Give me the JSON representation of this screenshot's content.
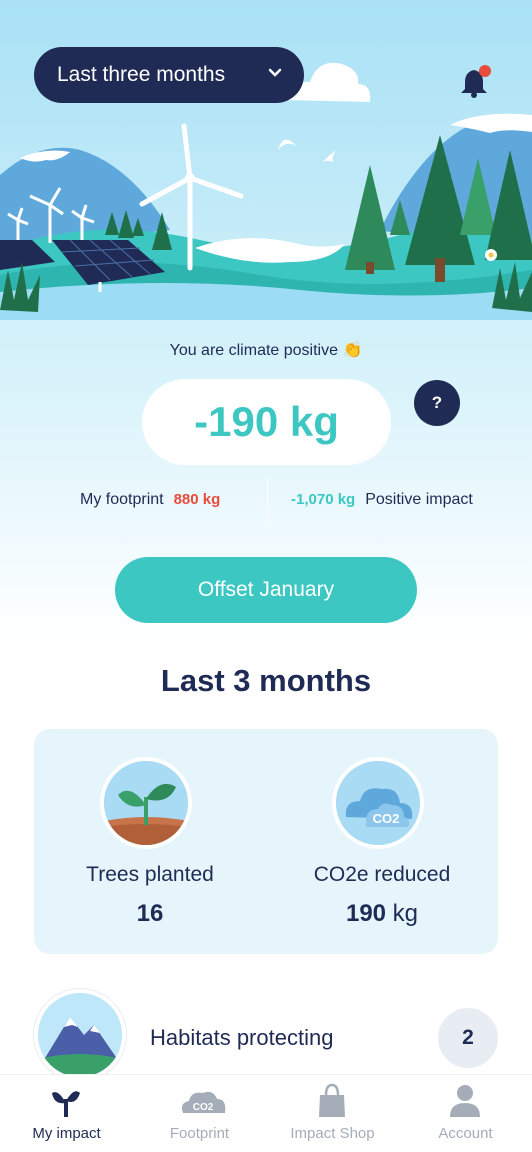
{
  "header": {
    "period_label": "Last three months",
    "period_icon": "chevron-down-icon",
    "notification_icon": "bell-icon",
    "notification_dot_color": "#e74c3c"
  },
  "summary": {
    "climate_label": "You are climate positive 👏",
    "net_value": "-190 kg",
    "help_label": "?",
    "footprint_label": "My footprint",
    "footprint_value": "880 kg",
    "positive_value": "-1,070 kg",
    "positive_label": "Positive impact",
    "offset_button": "Offset January"
  },
  "section": {
    "title": "Last 3 months"
  },
  "metrics": [
    {
      "label": "Trees planted",
      "value": "16",
      "unit": "",
      "icon": "sprout-icon"
    },
    {
      "label": "CO2e reduced",
      "value": "190",
      "unit": " kg",
      "icon": "co2-cloud-icon"
    }
  ],
  "habitat": {
    "label": "Habitats protecting",
    "count": "2",
    "icon": "mountain-icon"
  },
  "tabs": [
    {
      "label": "My impact",
      "icon": "sprout-icon",
      "active": true
    },
    {
      "label": "Footprint",
      "icon": "co2-cloud-icon",
      "active": false
    },
    {
      "label": "Impact Shop",
      "icon": "shopping-bag-icon",
      "active": false
    },
    {
      "label": "Account",
      "icon": "user-icon",
      "active": false
    }
  ],
  "colors": {
    "navy": "#1f2b55",
    "teal": "#3cc7c2",
    "red": "#e74c3c",
    "card_bg": "#e6f5fc"
  }
}
